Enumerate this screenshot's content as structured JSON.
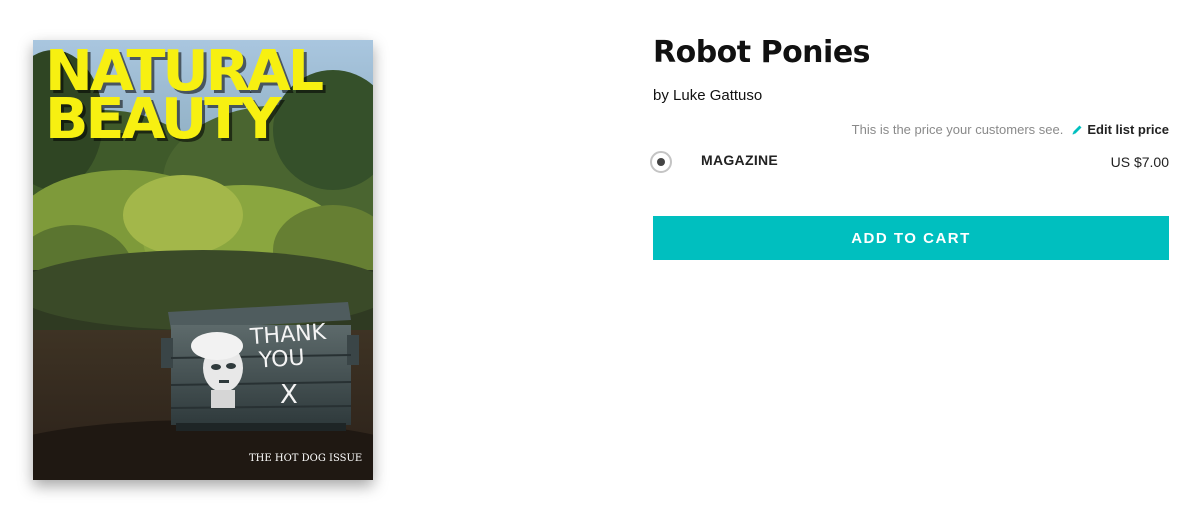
{
  "cover": {
    "title_line1": "NATURAL",
    "title_line2": "BEAUTY",
    "subtitle": "THE HOT DOG ISSUE",
    "graffiti_text": "THANK YOU",
    "graffiti_mark": "X",
    "title_color": "#f7f011"
  },
  "product": {
    "title": "Robot Ponies",
    "author": "by Luke Gattuso"
  },
  "pricing": {
    "note": "This is the price your customers see.",
    "edit_label": "Edit list price",
    "edit_icon": "pencil-icon"
  },
  "options": [
    {
      "label": "MAGAZINE",
      "price": "US $7.00",
      "selected": true
    }
  ],
  "cart": {
    "button_label": "ADD TO CART",
    "button_color": "#00bfbf"
  },
  "accent_color": "#00bfbf"
}
